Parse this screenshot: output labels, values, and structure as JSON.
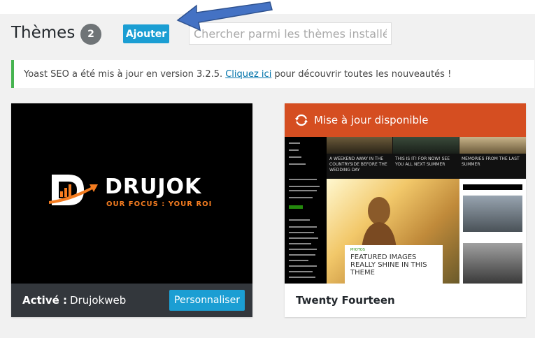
{
  "header": {
    "title": "Thèmes",
    "count": "2",
    "add_label": "Ajouter",
    "search_placeholder": "Chercher parmi les thèmes installés"
  },
  "notice": {
    "text_before": "Yoast SEO a été mis à jour en version 3.2.5.",
    "link": "Cliquez ici",
    "text_after": "pour découvrir toutes les nouveautés !"
  },
  "themes": [
    {
      "logo_main": "DRUJOK",
      "logo_tagline": "OUR FOCUS : YOUR ROI",
      "active_label": "Activé :",
      "name": "Drujokweb",
      "customize_label": "Personnaliser"
    },
    {
      "update_label": "Mise à jour disponible",
      "name": "Twenty Fourteen",
      "preview_tile_1": "A WEEKEND AWAY IN THE COUNTRYSIDE BEFORE THE WEDDING DAY",
      "preview_tile_2": "THIS IS IT! FOR NOW! SEE YOU ALL NEXT SUMMER",
      "preview_tile_3": "MEMORIES FROM THE LAST SUMMER",
      "preview_hero_heading": "FEATURED IMAGES REALLY SHINE IN THIS THEME"
    }
  ],
  "colors": {
    "accent": "#1b9ed3",
    "update": "#d54e21",
    "notice_border": "#46b450",
    "arrow": "#4472c4"
  }
}
